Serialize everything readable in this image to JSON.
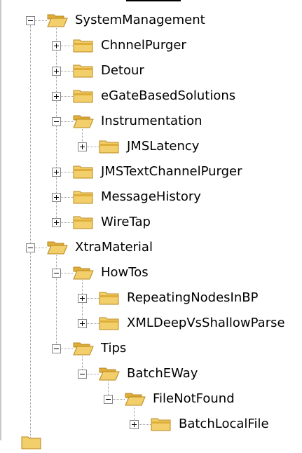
{
  "tree": {
    "items": [
      {
        "label": "SystemManagement",
        "expanded": true,
        "depth": 0,
        "icon": "folder-open-icon"
      },
      {
        "label": "ChnnelPurger",
        "expanded": false,
        "depth": 1,
        "icon": "folder-closed-icon"
      },
      {
        "label": "Detour",
        "expanded": false,
        "depth": 1,
        "icon": "folder-closed-icon"
      },
      {
        "label": "eGateBasedSolutions",
        "expanded": false,
        "depth": 1,
        "icon": "folder-closed-icon"
      },
      {
        "label": "Instrumentation",
        "expanded": true,
        "depth": 1,
        "icon": "folder-open-icon"
      },
      {
        "label": "JMSLatency",
        "expanded": false,
        "depth": 2,
        "icon": "folder-closed-icon"
      },
      {
        "label": "JMSTextChannelPurger",
        "expanded": false,
        "depth": 1,
        "icon": "folder-closed-icon"
      },
      {
        "label": "MessageHistory",
        "expanded": false,
        "depth": 1,
        "icon": "folder-closed-icon"
      },
      {
        "label": "WireTap",
        "expanded": false,
        "depth": 1,
        "icon": "folder-closed-icon"
      },
      {
        "label": "XtraMaterial",
        "expanded": true,
        "depth": 0,
        "icon": "folder-open-icon"
      },
      {
        "label": "HowTos",
        "expanded": true,
        "depth": 1,
        "icon": "folder-open-icon"
      },
      {
        "label": "RepeatingNodesInBP",
        "expanded": false,
        "depth": 2,
        "icon": "folder-closed-icon"
      },
      {
        "label": "XMLDeepVsShallowParse",
        "expanded": false,
        "depth": 2,
        "icon": "folder-closed-icon"
      },
      {
        "label": "Tips",
        "expanded": true,
        "depth": 1,
        "icon": "folder-open-icon"
      },
      {
        "label": "BatchEWay",
        "expanded": true,
        "depth": 2,
        "icon": "folder-open-icon"
      },
      {
        "label": "FileNotFound",
        "expanded": true,
        "depth": 3,
        "icon": "folder-open-icon"
      },
      {
        "label": "BatchLocalFile",
        "expanded": false,
        "depth": 4,
        "icon": "folder-closed-icon"
      }
    ]
  },
  "colors": {
    "folder_fill": "#f2cf6a",
    "folder_shade": "#dfae3a",
    "folder_outline": "#b8871f",
    "tree_line": "#9a9a9a"
  }
}
